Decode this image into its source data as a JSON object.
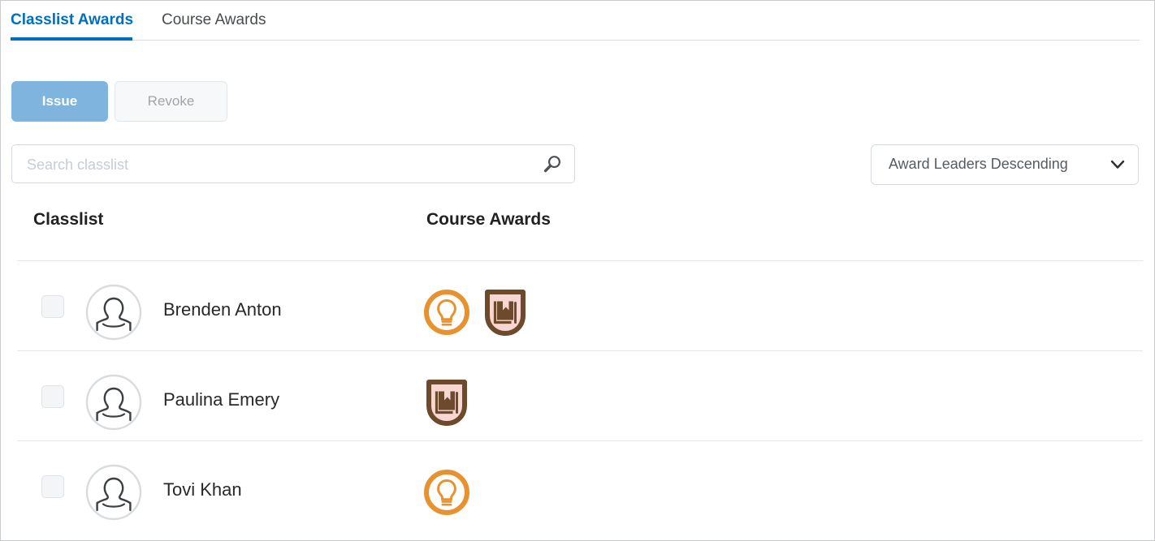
{
  "tabs": [
    {
      "label": "Classlist Awards",
      "active": true
    },
    {
      "label": "Course Awards",
      "active": false
    }
  ],
  "toggle": {
    "issue_label": "Issue",
    "revoke_label": "Revoke"
  },
  "search": {
    "placeholder": "Search classlist",
    "value": "",
    "icon": "search-icon"
  },
  "sort": {
    "selected": "Award Leaders Descending",
    "icon": "chevron-down-icon"
  },
  "columns": {
    "classlist": "Classlist",
    "course_awards": "Course Awards"
  },
  "rows": [
    {
      "name": "Brenden Anton",
      "checked": false,
      "avatar": "user-avatar-icon",
      "awards": [
        "lightbulb-award-badge",
        "book-award-badge"
      ]
    },
    {
      "name": "Paulina Emery",
      "checked": false,
      "avatar": "user-avatar-icon",
      "awards": [
        "book-award-badge"
      ]
    },
    {
      "name": "Tovi Khan",
      "checked": false,
      "avatar": "user-avatar-icon",
      "awards": [
        "lightbulb-award-badge"
      ]
    }
  ],
  "colors": {
    "tab_active": "#006FBF",
    "issue_button": "#7EB4DD",
    "badge_orange": "#E8922F",
    "badge_brown": "#6E4A2C",
    "badge_pink": "#F8D6D1"
  }
}
